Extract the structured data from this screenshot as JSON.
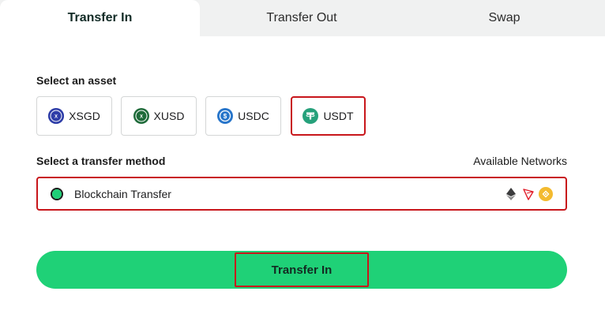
{
  "tabs": [
    {
      "label": "Transfer In",
      "active": true
    },
    {
      "label": "Transfer Out",
      "active": false
    },
    {
      "label": "Swap",
      "active": false
    }
  ],
  "asset_section": {
    "label": "Select an asset",
    "assets": [
      {
        "label": "XSGD",
        "icon": "xsgd-coin-icon",
        "color": "#2f3ea8",
        "selected": false
      },
      {
        "label": "XUSD",
        "icon": "xusd-coin-icon",
        "color": "#1f6b3a",
        "selected": false
      },
      {
        "label": "USDC",
        "icon": "usdc-coin-icon",
        "color": "#2775ca",
        "selected": false
      },
      {
        "label": "USDT",
        "icon": "usdt-coin-icon",
        "color": "#26a17b",
        "selected": true
      }
    ]
  },
  "method_section": {
    "label": "Select a transfer method",
    "networks_label": "Available Networks",
    "method": "Blockchain Transfer",
    "networks": [
      "ethereum-icon",
      "tron-icon",
      "bnb-chain-icon"
    ]
  },
  "cta": {
    "label": "Transfer In"
  },
  "colors": {
    "accent": "#1fd177",
    "highlight": "#c8161b"
  }
}
